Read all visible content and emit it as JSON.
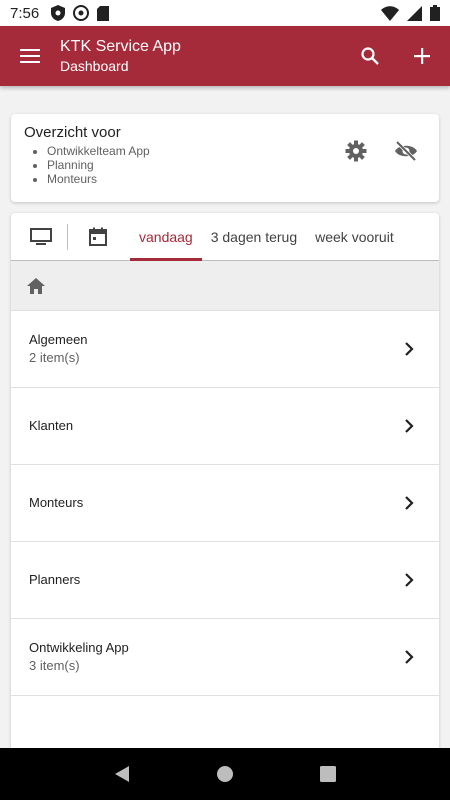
{
  "status_bar": {
    "time": "7:56"
  },
  "app_bar": {
    "title": "KTK Service App",
    "subtitle": "Dashboard"
  },
  "overview": {
    "heading": "Overzicht voor",
    "items": [
      "Ontwikkelteam App",
      "Planning",
      "Monteurs"
    ]
  },
  "tabs": [
    "vandaag",
    "3 dagen terug",
    "week vooruit"
  ],
  "active_tab": "vandaag",
  "rows": [
    {
      "label": "Algemeen",
      "sub": "2 item(s)"
    },
    {
      "label": "Klanten",
      "sub": ""
    },
    {
      "label": "Monteurs",
      "sub": ""
    },
    {
      "label": "Planners",
      "sub": ""
    },
    {
      "label": "Ontwikkeling App",
      "sub": "3 item(s)"
    }
  ],
  "colors": {
    "accent": "#a52a3a"
  }
}
